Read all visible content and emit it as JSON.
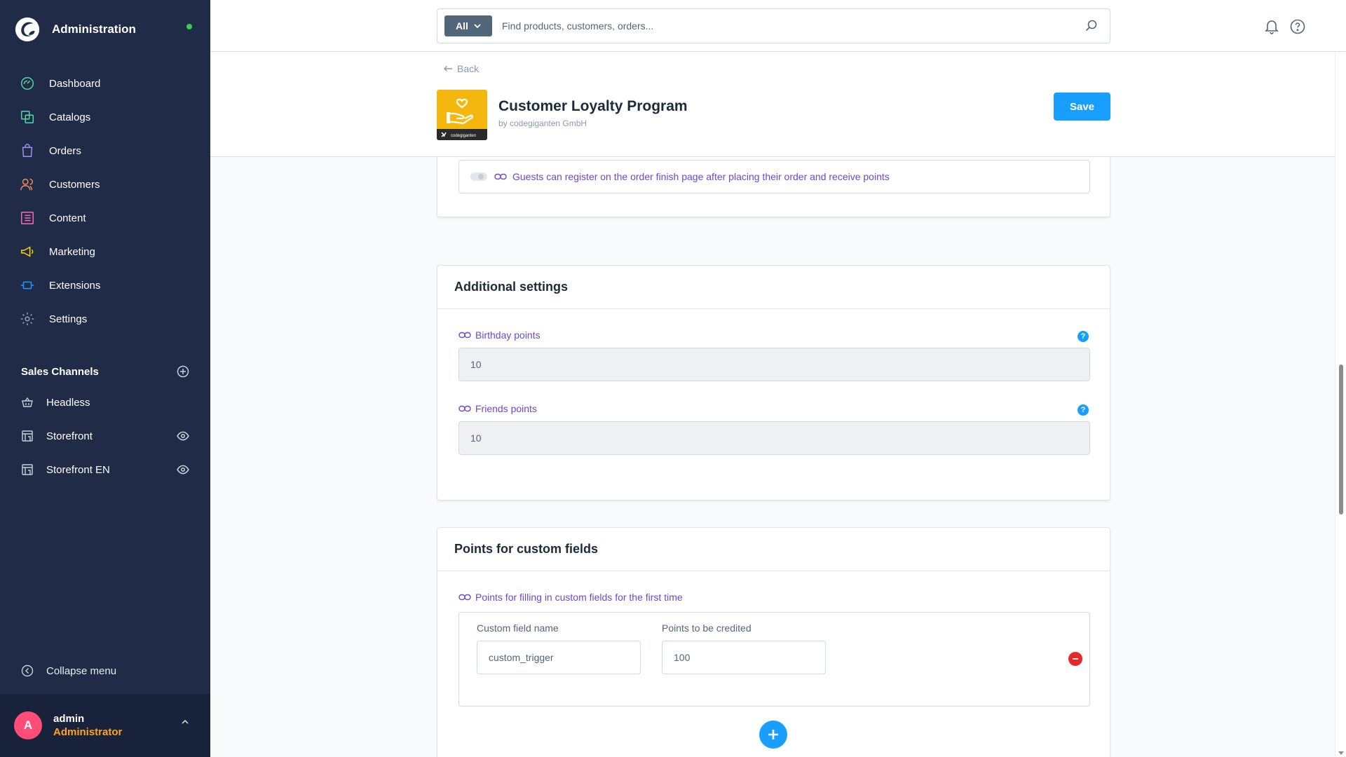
{
  "sidebar": {
    "title": "Administration",
    "nav": [
      {
        "label": "Dashboard",
        "icon": "dashboard-icon",
        "color": "#57d9a3"
      },
      {
        "label": "Catalogs",
        "icon": "catalog-icon",
        "color": "#57d9a3"
      },
      {
        "label": "Orders",
        "icon": "orders-icon",
        "color": "#a092f0"
      },
      {
        "label": "Customers",
        "icon": "customers-icon",
        "color": "#f88962"
      },
      {
        "label": "Content",
        "icon": "content-icon",
        "color": "#ff68b4"
      },
      {
        "label": "Marketing",
        "icon": "marketing-icon",
        "color": "#ffd700"
      },
      {
        "label": "Extensions",
        "icon": "extensions-icon",
        "color": "#189eff"
      },
      {
        "label": "Settings",
        "icon": "settings-icon",
        "color": "#9aa8b5"
      }
    ],
    "sales_channels_title": "Sales Channels",
    "sales_channels": [
      {
        "label": "Headless",
        "icon": "basket-icon",
        "visible": false
      },
      {
        "label": "Storefront",
        "icon": "storefront-icon",
        "visible": true
      },
      {
        "label": "Storefront EN",
        "icon": "storefront-icon",
        "visible": true
      }
    ],
    "collapse_label": "Collapse menu",
    "user": {
      "initial": "A",
      "name": "admin",
      "role": "Administrator"
    }
  },
  "search": {
    "type_label": "All",
    "placeholder": "Find products, customers, orders..."
  },
  "smartbar": {
    "back_label": "Back",
    "app_title": "Customer Loyalty Program",
    "vendor": "by codegiganten GmbH",
    "logo_text": "codegiganten",
    "save_label": "Save"
  },
  "guest_card": {
    "toggle_label": "Guests can register on the order finish page after placing their order and receive points",
    "toggle_on": false
  },
  "additional_settings": {
    "title": "Additional settings",
    "birthday_label": "Birthday points",
    "birthday_value": "10",
    "friends_label": "Friends points",
    "friends_value": "10"
  },
  "custom_fields": {
    "title": "Points for custom fields",
    "field_label": "Points for filling in custom fields for the first time",
    "name_col": "Custom field name",
    "points_col": "Points to be credited",
    "rows": [
      {
        "name": "custom_trigger",
        "points": "100"
      }
    ]
  },
  "colors": {
    "accent": "#189eff",
    "sidebar_bg": "#1f2b47",
    "label_purple": "#6b46d8",
    "danger": "#e9272b",
    "online": "#37d046"
  }
}
